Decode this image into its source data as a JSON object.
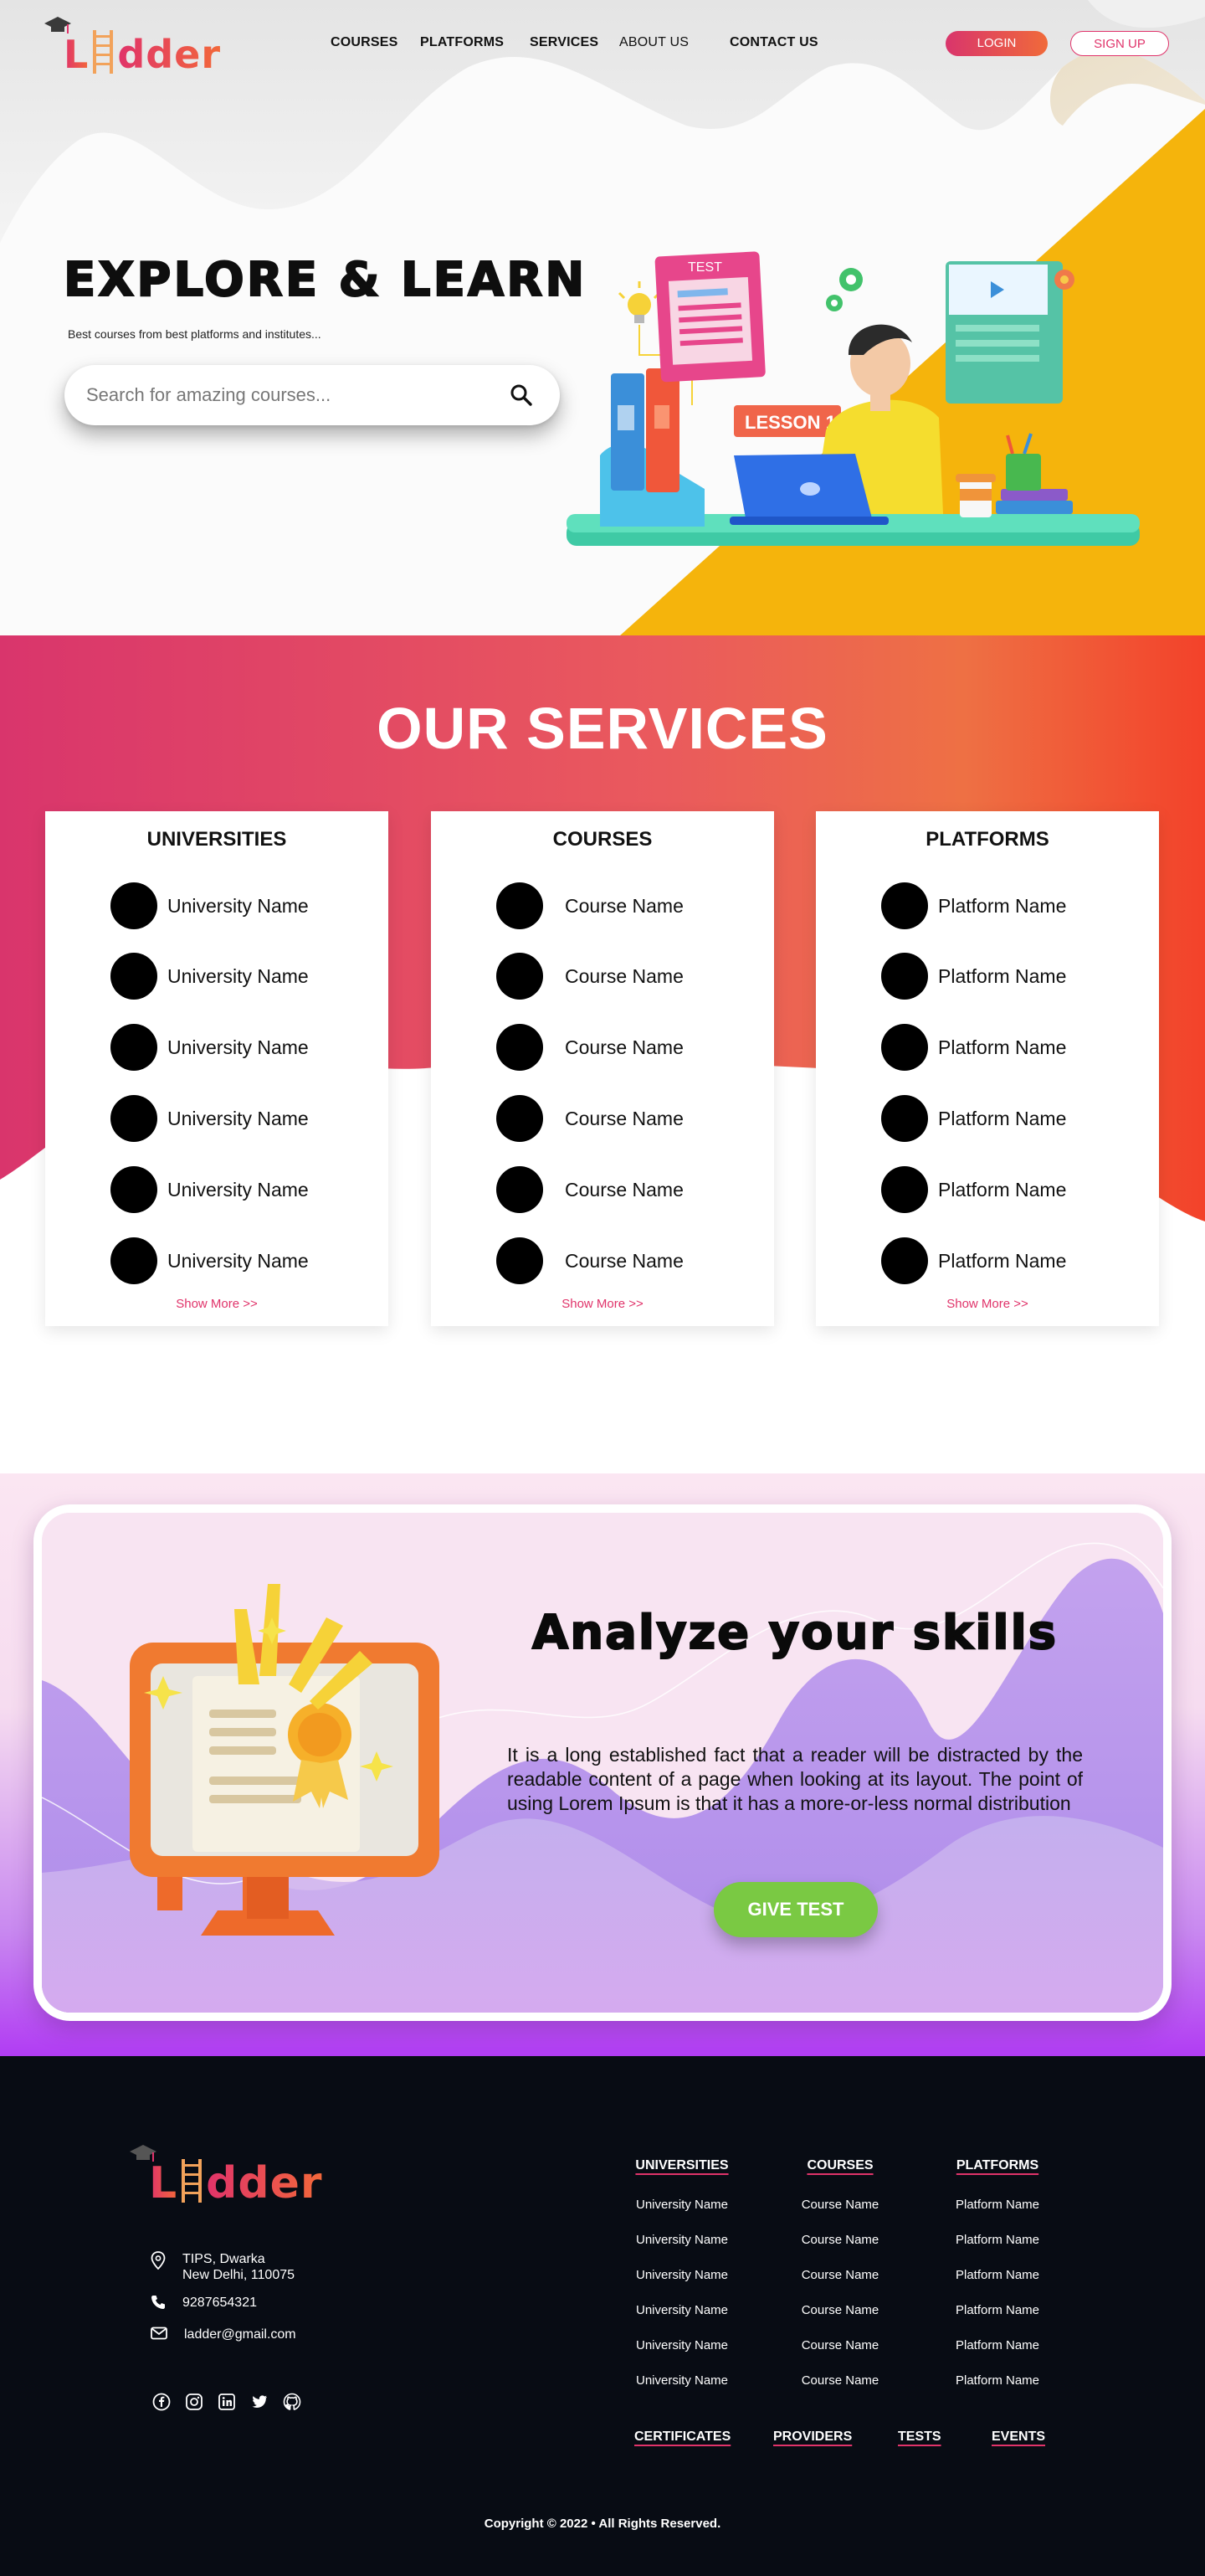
{
  "brand": {
    "name": "Ladder",
    "name_left": "L",
    "name_right": "dder"
  },
  "nav": {
    "items": [
      "COURSES",
      "PLATFORMS",
      "SERVICES",
      "ABOUT US",
      "CONTACT US"
    ],
    "login": "LOGIN",
    "signup": "SIGN UP"
  },
  "hero": {
    "title": "EXPLORE & LEARN",
    "subtitle": "Best courses from best platforms and institutes...",
    "search_placeholder": "Search for amazing courses...",
    "illus_test": "TEST",
    "illus_lesson": "LESSON 1"
  },
  "services": {
    "title": "OUR SERVICES",
    "show_more": "Show More >>",
    "cards": [
      {
        "title": "UNIVERSITIES",
        "items": [
          "University Name",
          "University Name",
          "University Name",
          "University Name",
          "University Name",
          "University Name"
        ]
      },
      {
        "title": "COURSES",
        "items": [
          "Course Name",
          "Course Name",
          "Course Name",
          "Course Name",
          "Course Name",
          "Course Name"
        ]
      },
      {
        "title": "PLATFORMS",
        "items": [
          "Platform Name",
          "Platform Name",
          "Platform Name",
          "Platform Name",
          "Platform Name",
          "Platform Name"
        ]
      }
    ]
  },
  "analyze": {
    "title": "Analyze your skills",
    "text": "It is a long established fact that a reader will be distracted by the readable content of a page when looking at its layout. The point of using Lorem Ipsum is that it has a more-or-less normal distribution",
    "button": "GIVE TEST"
  },
  "footer": {
    "address_line1": "TIPS, Dwarka",
    "address_line2": "New Delhi, 110075",
    "phone": "9287654321",
    "email": "ladder@gmail.com",
    "socials": [
      "facebook-icon",
      "instagram-icon",
      "linkedin-icon",
      "twitter-icon",
      "github-icon"
    ],
    "columns": [
      {
        "title": "UNIVERSITIES",
        "links": [
          "University Name",
          "University Name",
          "University Name",
          "University Name",
          "University Name",
          "University Name"
        ]
      },
      {
        "title": "COURSES",
        "links": [
          "Course Name",
          "Course Name",
          "Course Name",
          "Course Name",
          "Course Name",
          "Course Name"
        ]
      },
      {
        "title": "PLATFORMS",
        "links": [
          "Platform Name",
          "Platform Name",
          "Platform Name",
          "Platform Name",
          "Platform Name",
          "Platform Name"
        ]
      }
    ],
    "bottom_links": [
      "CERTIFICATES",
      "PROVIDERS",
      "TESTS",
      "EVENTS"
    ],
    "copyright": "Copyright © 2022 • All Rights Reserved."
  },
  "colors": {
    "brand_pink": "#e0336a",
    "brand_orange": "#f2683a",
    "hero_yellow": "#f5b40c",
    "test_green": "#7ac943",
    "footer_bg": "#080c14"
  }
}
